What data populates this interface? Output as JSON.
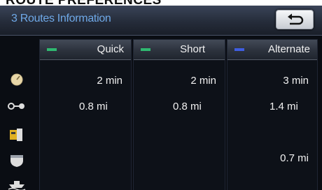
{
  "caption": "ROUTE PREFERENCES",
  "title": "3 Routes Information",
  "back_button": {
    "icon": "back-arrow-icon"
  },
  "row_icons": [
    "clock-icon",
    "route-distance-icon",
    "toll-road-icon",
    "highway-icon",
    "ferry-icon"
  ],
  "routes": [
    {
      "label": "Quick",
      "color": "#2fb870",
      "time": "2 min",
      "distance": "0.8 mi",
      "toll": "",
      "highway": "",
      "ferry": ""
    },
    {
      "label": "Short",
      "color": "#2fb870",
      "time": "2 min",
      "distance": "0.8 mi",
      "toll": "",
      "highway": "",
      "ferry": ""
    },
    {
      "label": "Alternate",
      "color": "#3f5ee0",
      "time": "3 min",
      "distance": "1.4 mi",
      "toll": "",
      "highway": "0.7 mi",
      "ferry": ""
    }
  ]
}
